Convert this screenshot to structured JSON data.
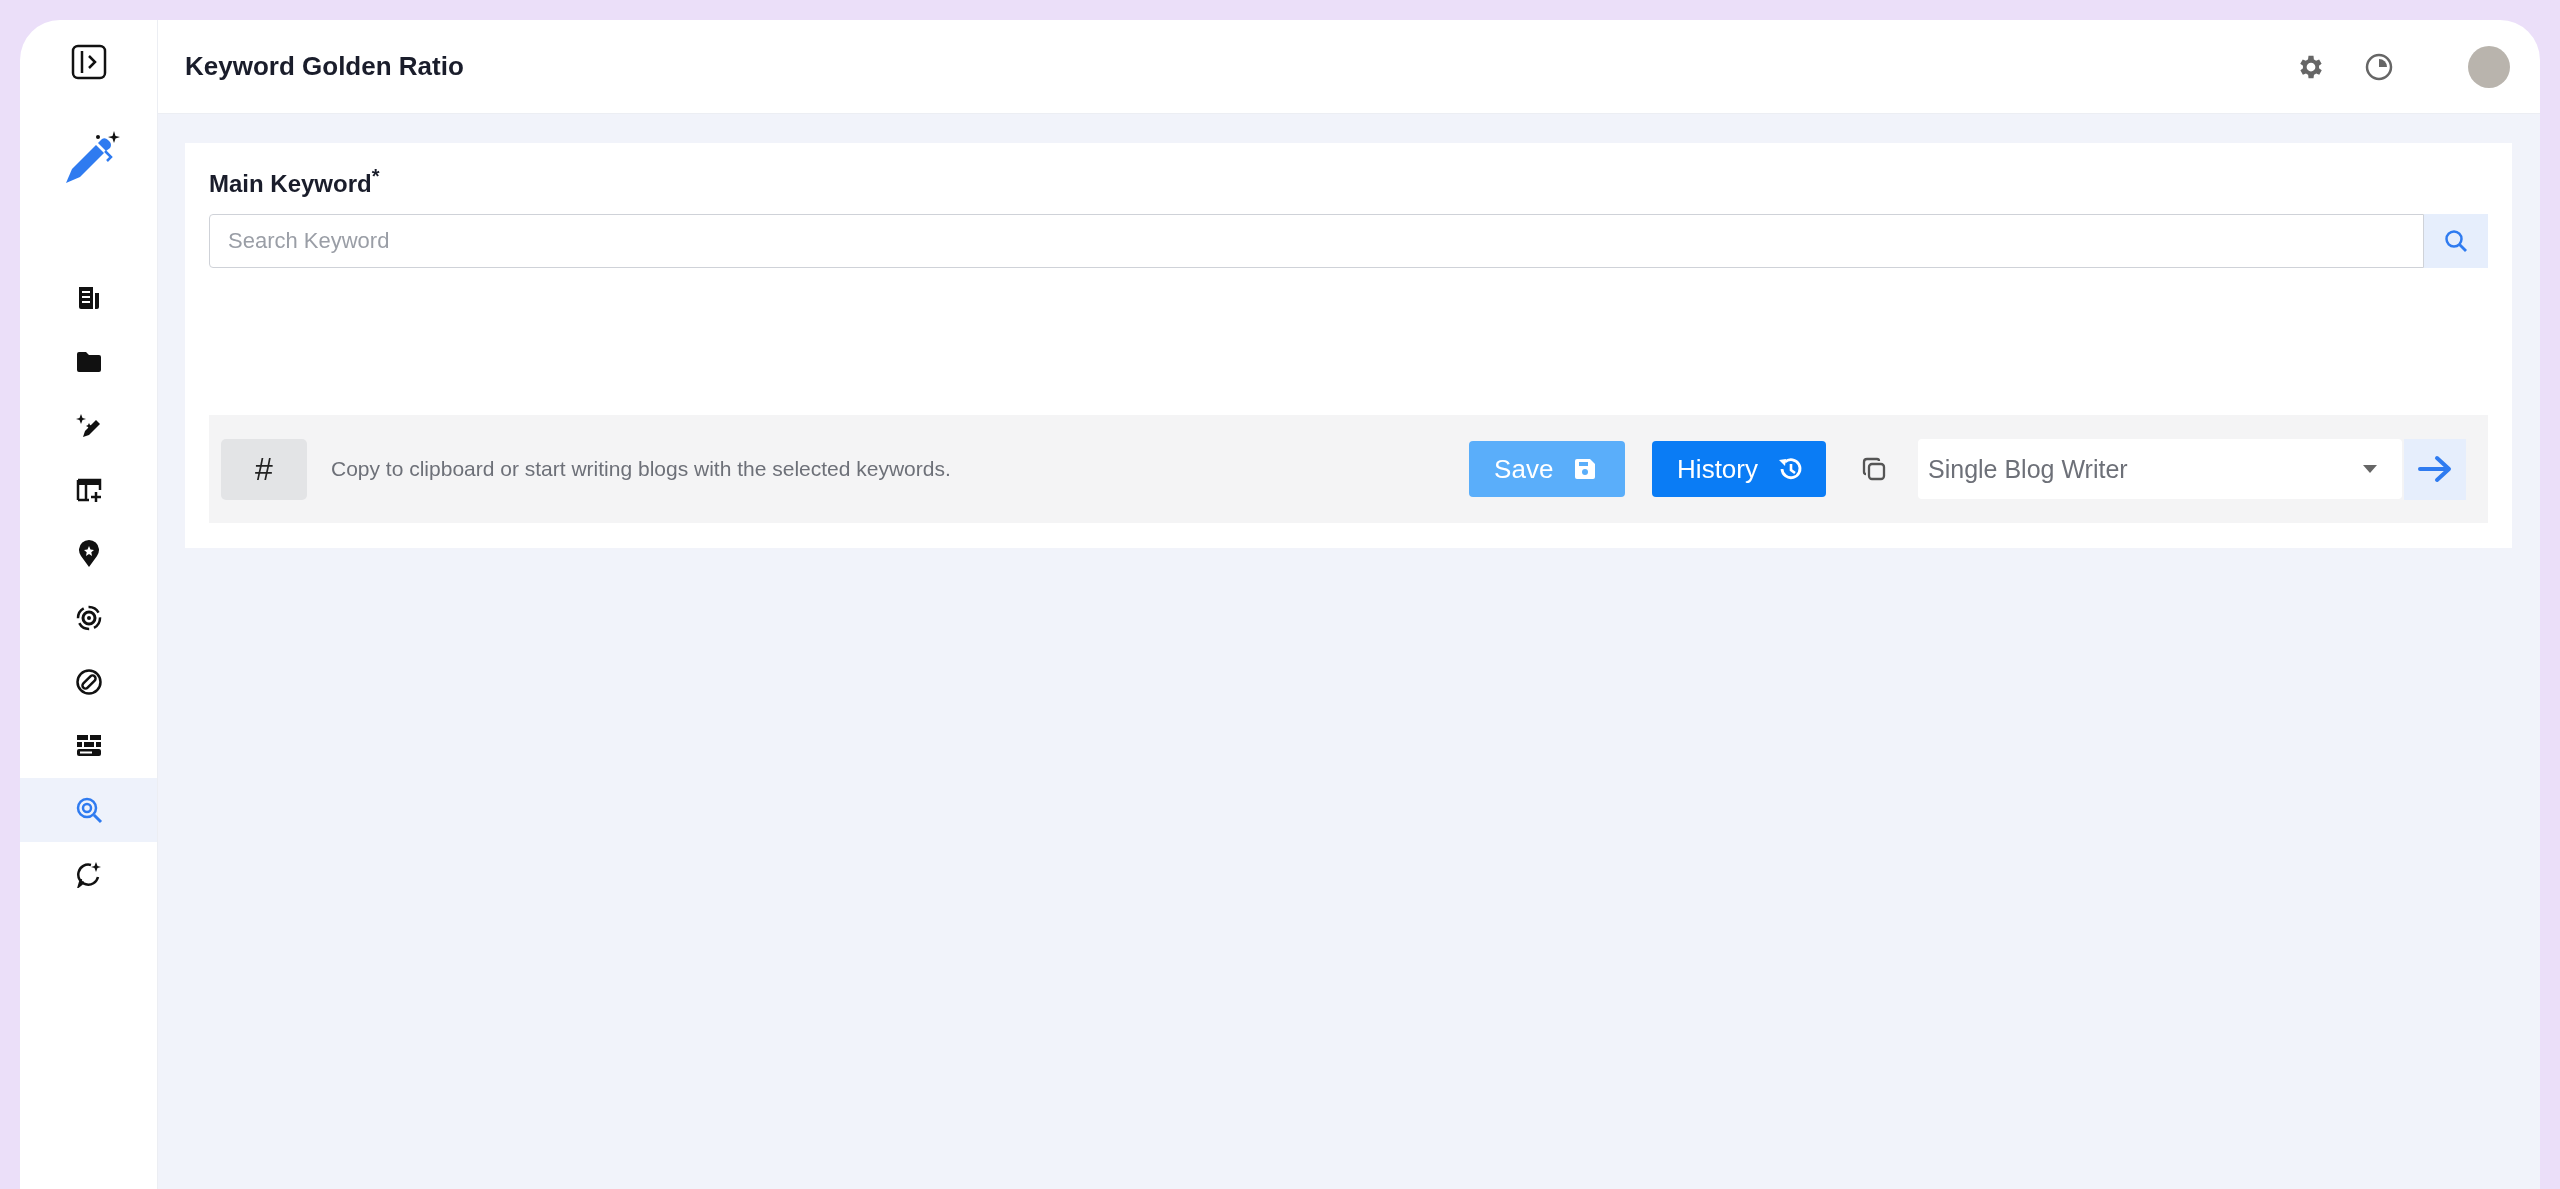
{
  "header": {
    "title": "Keyword Golden Ratio"
  },
  "sidebar": {
    "items": [
      {
        "kind": "document",
        "selected": false
      },
      {
        "kind": "folder",
        "selected": false
      },
      {
        "kind": "pen-sparkle",
        "selected": false
      },
      {
        "kind": "calendar-add",
        "selected": false
      },
      {
        "kind": "pin",
        "selected": false
      },
      {
        "kind": "target",
        "selected": false
      },
      {
        "kind": "link",
        "selected": false
      },
      {
        "kind": "bricks",
        "selected": false
      },
      {
        "kind": "search-target",
        "selected": true
      },
      {
        "kind": "chat-sparkle",
        "selected": false
      }
    ]
  },
  "form": {
    "label": "Main Keyword$^{*}$",
    "search": {
      "placeholder": "Search Keyword"
    }
  },
  "toolbar": {
    "hash_button": "#",
    "hint": "Copy to clipboard or start writing blogs with the selected keywords.",
    "save_button": {
      "label": "Save",
      "disabled": true
    },
    "history_button": {
      "label": "History"
    },
    "writer_select": {
      "value": "Single Blog Writer"
    }
  }
}
